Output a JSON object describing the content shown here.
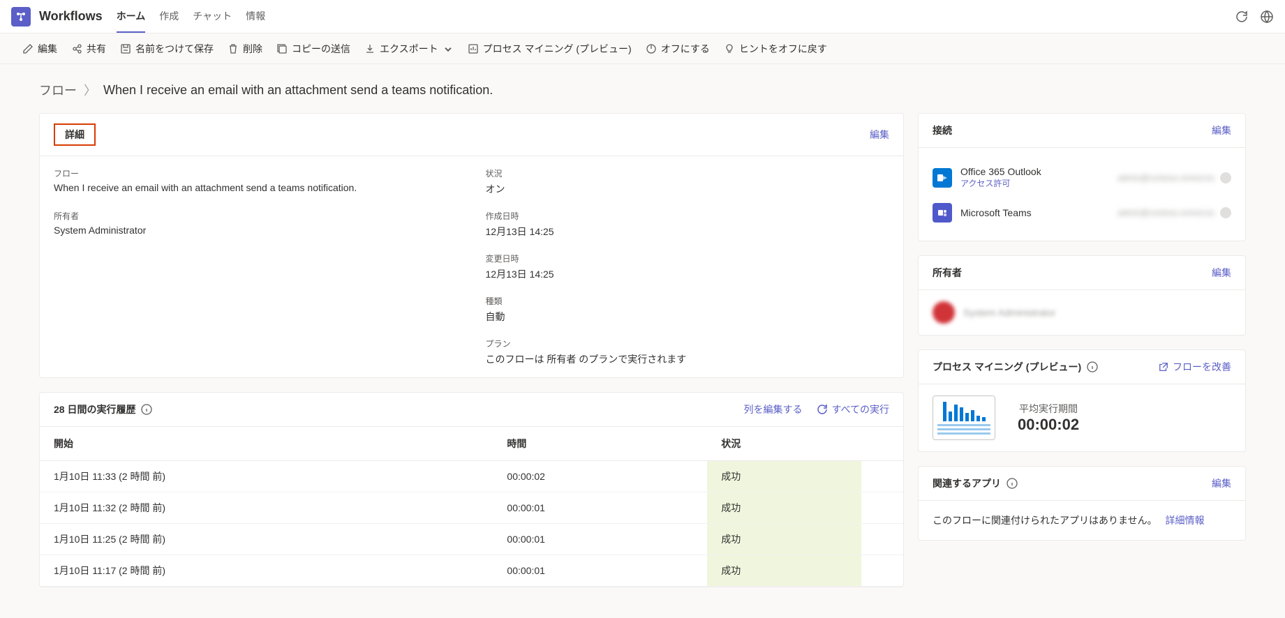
{
  "header": {
    "app_title": "Workflows",
    "tabs": [
      "ホーム",
      "作成",
      "チャット",
      "情報"
    ],
    "active_tab": 0
  },
  "toolbar": {
    "edit": "編集",
    "share": "共有",
    "save_as": "名前をつけて保存",
    "delete": "削除",
    "send_copy": "コピーの送信",
    "export": "エクスポート",
    "process_mining": "プロセス マイニング (プレビュー)",
    "turn_off": "オフにする",
    "hints_reset": "ヒントをオフに戻す"
  },
  "breadcrumb": {
    "root": "フロー",
    "sep": "〉",
    "current": "When I receive an email with an attachment send a teams notification."
  },
  "details": {
    "card_title": "詳細",
    "edit": "編集",
    "flow_label": "フロー",
    "flow_value": "When I receive an email with an attachment send a teams notification.",
    "owner_label": "所有者",
    "owner_value": "System Administrator",
    "status_label": "状況",
    "status_value": "オン",
    "created_label": "作成日時",
    "created_value": "12月13日 14:25",
    "modified_label": "変更日時",
    "modified_value": "12月13日 14:25",
    "type_label": "種類",
    "type_value": "自動",
    "plan_label": "プラン",
    "plan_value": "このフローは 所有者 のプランで実行されます"
  },
  "history": {
    "title": "28 日間の実行履歴",
    "edit_columns": "列を編集する",
    "all_runs": "すべての実行",
    "cols": {
      "start": "開始",
      "duration": "時間",
      "status": "状況"
    },
    "rows": [
      {
        "start": "1月10日 11:33 (2 時間 前)",
        "duration": "00:00:02",
        "status": "成功"
      },
      {
        "start": "1月10日 11:32 (2 時間 前)",
        "duration": "00:00:01",
        "status": "成功"
      },
      {
        "start": "1月10日 11:25 (2 時間 前)",
        "duration": "00:00:01",
        "status": "成功"
      },
      {
        "start": "1月10日 11:17 (2 時間 前)",
        "duration": "00:00:01",
        "status": "成功"
      }
    ]
  },
  "connections": {
    "title": "接続",
    "edit": "編集",
    "items": [
      {
        "name": "Office 365 Outlook",
        "sub": "アクセス許可",
        "account": "admin@contoso.onmicros"
      },
      {
        "name": "Microsoft Teams",
        "sub": "",
        "account": "admin@contoso.onmicros"
      }
    ]
  },
  "owners": {
    "title": "所有者",
    "edit": "編集",
    "name": "System Administrator"
  },
  "process_mining": {
    "title": "プロセス マイニング (プレビュー)",
    "improve_flow": "フローを改善",
    "avg_label": "平均実行期間",
    "avg_value": "00:00:02"
  },
  "related_apps": {
    "title": "関連するアプリ",
    "edit": "編集",
    "message": "このフローに関連付けられたアプリはありません。",
    "link": "詳細情報"
  }
}
